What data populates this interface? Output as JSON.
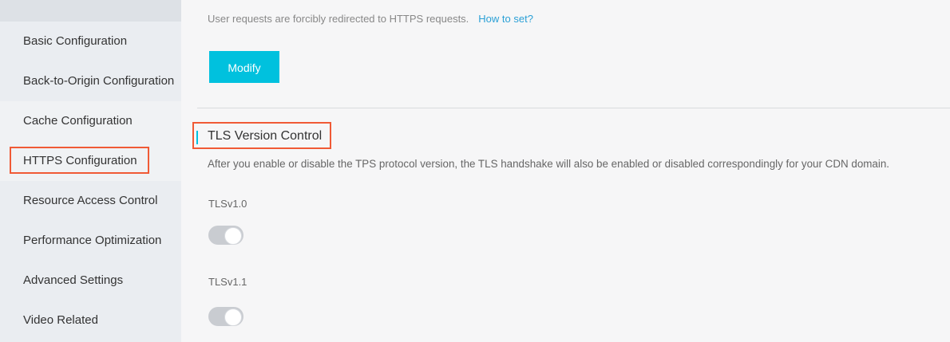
{
  "sidebar": {
    "items": [
      {
        "label": "Basic Configuration"
      },
      {
        "label": "Back-to-Origin Configuration"
      },
      {
        "label": "Cache Configuration"
      },
      {
        "label": "HTTPS Configuration"
      },
      {
        "label": "Resource Access Control"
      },
      {
        "label": "Performance Optimization"
      },
      {
        "label": "Advanced Settings"
      },
      {
        "label": "Video Related"
      }
    ],
    "active_label": "HTTPS Configuration"
  },
  "main": {
    "force_redirect": {
      "description": "User requests are forcibly redirected to HTTPS requests.",
      "help_link": "How to set?",
      "modify_label": "Modify"
    },
    "tls_section": {
      "title": "TLS Version Control",
      "description": "After you enable or disable the TPS protocol version, the TLS handshake will also be enabled or disabled correspondingly for your CDN domain.",
      "versions": [
        {
          "label": "TLSv1.0",
          "enabled": false
        },
        {
          "label": "TLSv1.1",
          "enabled": false
        }
      ]
    }
  },
  "colors": {
    "accent": "#00c1de",
    "highlight_border": "#f05a35",
    "link": "#2aa0d6",
    "sidebar_bg": "#eaedf1",
    "toggle_off": "#c9ccd1"
  }
}
